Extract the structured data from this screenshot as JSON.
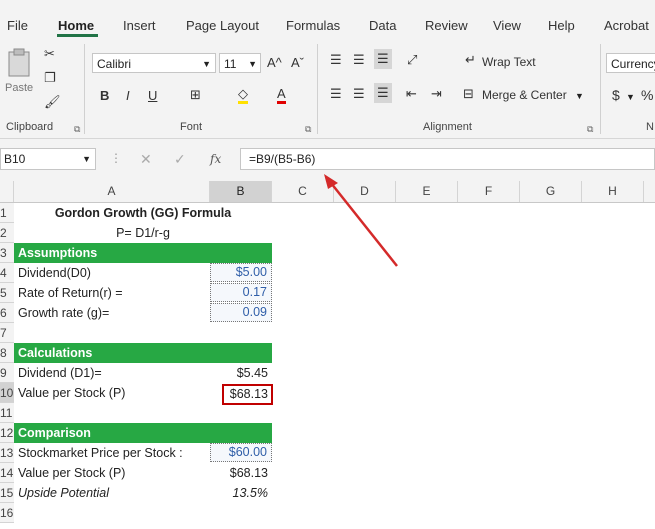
{
  "tabs": [
    "File",
    "Home",
    "Insert",
    "Page Layout",
    "Formulas",
    "Data",
    "Review",
    "View",
    "Help",
    "Acrobat"
  ],
  "ribbon": {
    "paste_label": "Paste",
    "font_name": "Calibri",
    "font_size": "11",
    "grow_font": "A^",
    "shrink_font": "Aˇ",
    "bold": "B",
    "italic": "I",
    "underline": "U",
    "wrap_text": "Wrap Text",
    "merge_center": "Merge & Center",
    "number_format": "Currency",
    "currency_symbol": "$",
    "percent_symbol": "%",
    "groups": {
      "clipboard": "Clipboard",
      "font": "Font",
      "alignment": "Alignment",
      "number": "N"
    }
  },
  "formula_bar": {
    "name_box": "B10",
    "fx": "fx",
    "formula": "=B9/(B5-B6)"
  },
  "columns": [
    "A",
    "B",
    "C",
    "D",
    "E",
    "F",
    "G",
    "H"
  ],
  "rows": [
    "1",
    "2",
    "3",
    "4",
    "5",
    "6",
    "7",
    "8",
    "9",
    "10",
    "11",
    "12",
    "13",
    "14",
    "15",
    "16"
  ],
  "sheet": {
    "title": "Gordon Growth (GG) Formula",
    "subtitle": "P= D1/r-g",
    "assumptions_header": "Assumptions",
    "dividend_label": "Dividend(D0)",
    "dividend_value": "$5.00",
    "return_label": "Rate of Return(r) =",
    "return_value": "0.17",
    "growth_label": "Growth rate (g)=",
    "growth_value": "0.09",
    "calculations_header": "Calculations",
    "d1_label": "Dividend (D1)=",
    "d1_value": "$5.45",
    "value_label": "Value per Stock (P)",
    "value_value": "$68.13",
    "comparison_header": "Comparison",
    "market_label": "Stockmarket Price per Stock :",
    "market_value": "$60.00",
    "value2_label": "Value per Stock (P)",
    "value2_value": "$68.13",
    "upside_label": "Upside Potential",
    "upside_value": "13.5%"
  },
  "colors": {
    "accent_green": "#27a844",
    "highlight_red": "#c00000",
    "input_blue": "#2f5ea8"
  }
}
